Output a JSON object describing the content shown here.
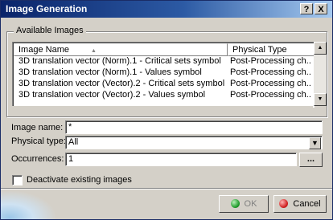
{
  "window": {
    "title": "Image Generation",
    "help_symbol": "?",
    "close_symbol": "X"
  },
  "images_group": {
    "label": "Available Images",
    "columns": [
      "Image Name",
      "Physical Type"
    ],
    "rows": [
      {
        "name": "3D translation vector (Norm).1 - Critical sets symbol",
        "type": "Post-Processing ch..."
      },
      {
        "name": "3D translation vector (Norm).1 - Values symbol",
        "type": "Post-Processing ch..."
      },
      {
        "name": "3D translation vector (Vector).2 - Critical sets symbol",
        "type": "Post-Processing ch..."
      },
      {
        "name": "3D translation vector (Vector).2 - Values symbol",
        "type": "Post-Processing ch..."
      }
    ]
  },
  "form": {
    "image_name_label": "Image name:",
    "image_name_value": "*",
    "physical_type_label": "Physical type:",
    "physical_type_value": "All",
    "occurrences_label": "Occurrences:",
    "occurrences_value": "1",
    "browse_label": "..."
  },
  "deactivate_checkbox": {
    "label": "Deactivate existing images",
    "checked": false
  },
  "buttons": {
    "ok_label": "OK",
    "cancel_label": "Cancel"
  },
  "colors": {
    "title_bar": "#0a246a",
    "dialog_bg": "#d4d0c8",
    "ok_icon": "#1e9a2a",
    "cancel_icon": "#d02020"
  },
  "icons": [
    "help-icon",
    "close-icon",
    "sort-arrow-icon",
    "scroll-up-icon",
    "scroll-down-icon",
    "dropdown-arrow-icon",
    "green-dot-icon",
    "red-dot-icon"
  ]
}
